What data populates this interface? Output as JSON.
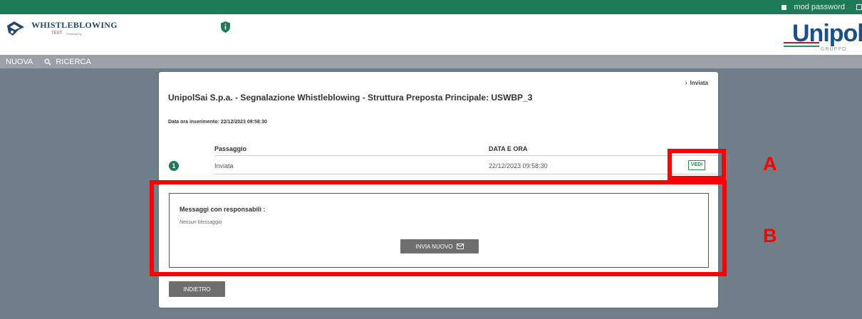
{
  "topbar": {
    "mod_password": "mod password"
  },
  "header": {
    "logo_title": "WHISTLEBLOWING",
    "logo_env": "TEST",
    "logo_powered": "Powered by",
    "brand": "Unipol",
    "brand_sub": "GRUPPO"
  },
  "nav": {
    "new_label": "NUOVA",
    "search_label": "RICERCA"
  },
  "card": {
    "breadcrumb_current": "Inviata",
    "title": "UnipolSai S.p.a. - Segnalazione Whistleblowing - Struttura Preposta Principale: USWBP_3",
    "inserted_label": "Data ora inserimento: 22/12/2023 09:58:30",
    "steps_table": {
      "headers": [
        "Passaggio",
        "DATA E ORA"
      ],
      "rows": [
        {
          "num": "1",
          "step": "Inviata",
          "datetime": "22/12/2023 09:58:30",
          "action": "VEDI"
        }
      ]
    },
    "messages": {
      "title": "Messaggi con responsabili :",
      "empty": "Nessun Messaggio",
      "send_button": "INVIA NUOVO"
    },
    "back_button": "INDIETRO"
  },
  "annotations": {
    "label_a": "A",
    "label_b": "B",
    "color": "#ff0000"
  },
  "colors": {
    "brand_green": "#1e7a58",
    "brand_blue": "#1d4f85",
    "background": "#6f7e87"
  }
}
